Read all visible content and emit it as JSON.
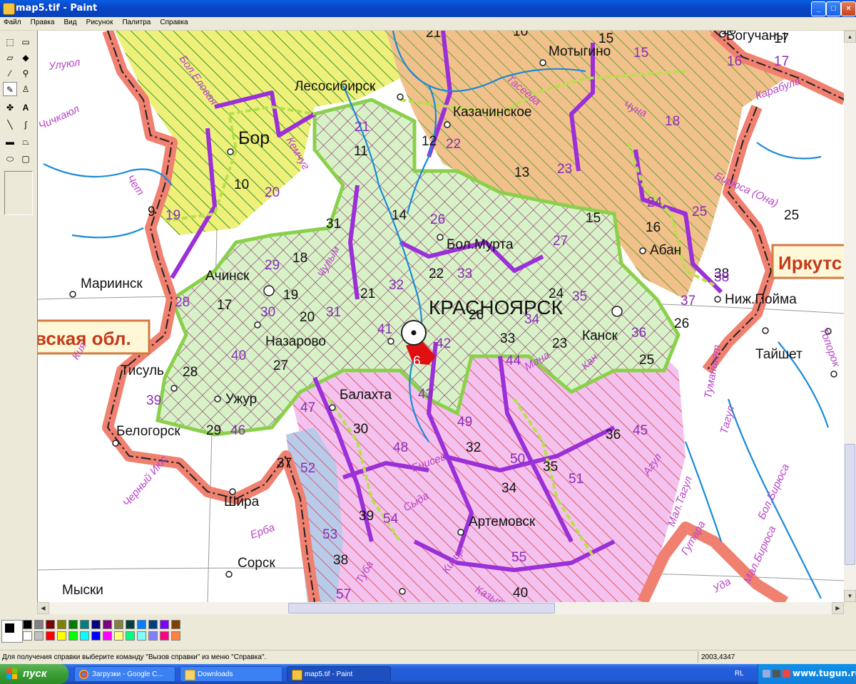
{
  "window": {
    "title": "map5.tif - Paint",
    "minimize": "_",
    "maximize": "□",
    "close": "×"
  },
  "menu": [
    "Файл",
    "Правка",
    "Вид",
    "Рисунок",
    "Палитра",
    "Справка"
  ],
  "tools": [
    {
      "icon": "free-select-icon",
      "glyph": "⬚"
    },
    {
      "icon": "select-icon",
      "glyph": "▭"
    },
    {
      "icon": "eraser-icon",
      "glyph": "▱"
    },
    {
      "icon": "fill-icon",
      "glyph": "◆"
    },
    {
      "icon": "color-picker-icon",
      "glyph": "⁄"
    },
    {
      "icon": "magnifier-icon",
      "glyph": "⚲"
    },
    {
      "icon": "pencil-icon",
      "glyph": "✎"
    },
    {
      "icon": "brush-icon",
      "glyph": "♙"
    },
    {
      "icon": "airbrush-icon",
      "glyph": "✤"
    },
    {
      "icon": "text-icon",
      "glyph": "A"
    },
    {
      "icon": "line-icon",
      "glyph": "╲"
    },
    {
      "icon": "curve-icon",
      "glyph": "∫"
    },
    {
      "icon": "rectangle-icon",
      "glyph": "▬"
    },
    {
      "icon": "polygon-icon",
      "glyph": "⏢"
    },
    {
      "icon": "ellipse-icon",
      "glyph": "⬭"
    },
    {
      "icon": "rounded-rectangle-icon",
      "glyph": "▢"
    }
  ],
  "palette": {
    "row1": [
      "#000000",
      "#808080",
      "#800000",
      "#808000",
      "#008000",
      "#008080",
      "#000080",
      "#800080",
      "#808040",
      "#004040",
      "#0080ff",
      "#004080",
      "#8000ff",
      "#804000"
    ],
    "row2": [
      "#ffffff",
      "#c0c0c0",
      "#ff0000",
      "#ffff00",
      "#00ff00",
      "#00ffff",
      "#0000ff",
      "#ff00ff",
      "#ffff80",
      "#00ff80",
      "#80ffff",
      "#8080ff",
      "#ff0080",
      "#ff8040"
    ]
  },
  "status": {
    "help": "Для получения справки выберите команду \"Вызов справки\" из меню \"Справка\".",
    "coords": "2003,4347"
  },
  "taskbar": {
    "start": "пуск",
    "tasks": [
      "Загрузки - Google C...",
      "Downloads",
      "map5.tif - Paint"
    ],
    "lang": "RL",
    "watermark": "www.tugun.ru"
  },
  "map": {
    "capital": "КРАСНОЯРСК",
    "cities": {
      "boguchany": "Богучаны",
      "motygino": "Мотыгино",
      "lesosibirsk": "Лесосибирск",
      "kazachinskoe": "Казачинское",
      "bor": "Бор",
      "bol_murta": "Бол.Мурта",
      "aban": "Абан",
      "achinsk": "Ачинск",
      "mariinsk": "Мариинск",
      "nazarovo": "Назарово",
      "kansk": "Канск",
      "nizh_poima": "Ниж.Пойма",
      "taishet": "Тайшет",
      "tisul": "Тисуль",
      "uzhur": "Ужур",
      "balakhta": "Балахта",
      "belogorsk": "Белогорск",
      "shira": "Шира",
      "artemovsk": "Артемовск",
      "sorsk": "Сорск",
      "myski": "Мыски"
    },
    "regions": {
      "irkutsk": "Иркутс",
      "kemerovo": "вская обл."
    },
    "rivers": [
      "Улуюл",
      "Бол.Еловая",
      "Чичкаюл",
      "Чулым",
      "Кемчуг",
      "Тасеева",
      "Чуна",
      "Карабула",
      "Бирюса (Она)",
      "Кан",
      "Бол.Бирюса",
      "Гутара",
      "Мал.Бирюса",
      "Уда",
      "Туманшет",
      "Тагул",
      "Топорок",
      "Агул",
      "Мал.Тагул",
      "Сыда",
      "Туба",
      "Кизир",
      "Казыр",
      "Ерба",
      "Черный Июс",
      "Енисей",
      "Чет",
      "Кия",
      "Мана"
    ],
    "numbers_black": [
      "9",
      "10",
      "11",
      "12",
      "13",
      "14",
      "15",
      "16",
      "15",
      "16",
      "17",
      "17",
      "18",
      "19",
      "20",
      "21",
      "21",
      "22",
      "23",
      "24",
      "25",
      "25",
      "26",
      "26",
      "27",
      "28",
      "29",
      "30",
      "31",
      "32",
      "33",
      "34",
      "35",
      "36",
      "37",
      "38",
      "38",
      "39",
      "40",
      "10"
    ],
    "numbers_purple": [
      "15",
      "16",
      "17",
      "18",
      "19",
      "20",
      "21",
      "22",
      "23",
      "24",
      "25",
      "26",
      "27",
      "28",
      "29",
      "30",
      "31",
      "32",
      "33",
      "34",
      "35",
      "36",
      "37",
      "38",
      "39",
      "40",
      "41",
      "42",
      "43",
      "44",
      "45",
      "46",
      "47",
      "48",
      "49",
      "50",
      "51",
      "52",
      "53",
      "54",
      "55",
      "57",
      "6",
      "13"
    ]
  }
}
